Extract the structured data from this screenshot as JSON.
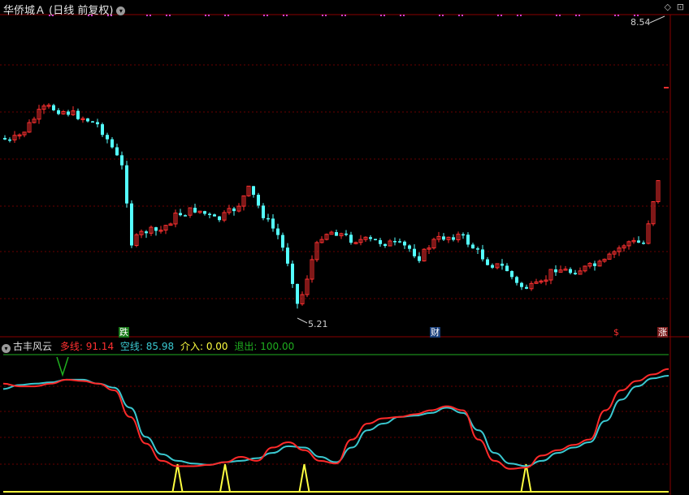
{
  "header": {
    "title": "华侨城Ａ (日线 前复权)",
    "corner_icons": [
      "diamond-icon",
      "expand-icon"
    ]
  },
  "price_axis": {
    "top_label": "8.54",
    "low_label": "5.21"
  },
  "markers": [
    {
      "id": "die",
      "text": "跌",
      "bg": "#1a7a1a",
      "fg": "#ffffff"
    },
    {
      "id": "cai",
      "text": "财",
      "bg": "#1a3f7a",
      "fg": "#ffffff"
    },
    {
      "id": "dollar",
      "text": "$",
      "bg": "#000000",
      "fg": "#ff3030"
    },
    {
      "id": "zhang",
      "text": "涨",
      "bg": "#7a1a1a",
      "fg": "#ffffff"
    }
  ],
  "indicator": {
    "name": "古丰风云",
    "multi_label": "多线:",
    "multi_value": "91.14",
    "short_label": "空线:",
    "short_value": "85.98",
    "entry_label": "介入:",
    "entry_value": "0.00",
    "exit_label": "退出:",
    "exit_value": "100.00"
  },
  "colors": {
    "up": "#ff3030",
    "down": "#54ffff",
    "multi": "#ff2a2a",
    "short": "#3ac8d0",
    "entry": "#ffff40",
    "exit": "#1fae1f",
    "grid": "#6a0000"
  },
  "chart_data": {
    "type": "candlestick",
    "low_marker_price": 5.21,
    "high_marker_price": 8.54,
    "indicator_series": {
      "multi_line": [
        80,
        78,
        78,
        80,
        83,
        82,
        80,
        75,
        55,
        35,
        22,
        18,
        18,
        19,
        21,
        25,
        22,
        32,
        36,
        30,
        22,
        20,
        38,
        50,
        54,
        55,
        57,
        60,
        63,
        60,
        38,
        22,
        16,
        17,
        26,
        30,
        34,
        38,
        60,
        75,
        82,
        87,
        91
      ],
      "short_line": [
        76,
        79,
        80,
        81,
        83,
        83,
        80,
        77,
        62,
        40,
        27,
        22,
        20,
        19,
        21,
        22,
        24,
        28,
        33,
        32,
        25,
        21,
        32,
        45,
        50,
        55,
        56,
        58,
        62,
        58,
        45,
        28,
        20,
        18,
        22,
        28,
        32,
        36,
        52,
        68,
        78,
        84,
        86
      ],
      "entry_spikes": [
        11,
        14,
        19,
        33
      ]
    }
  }
}
